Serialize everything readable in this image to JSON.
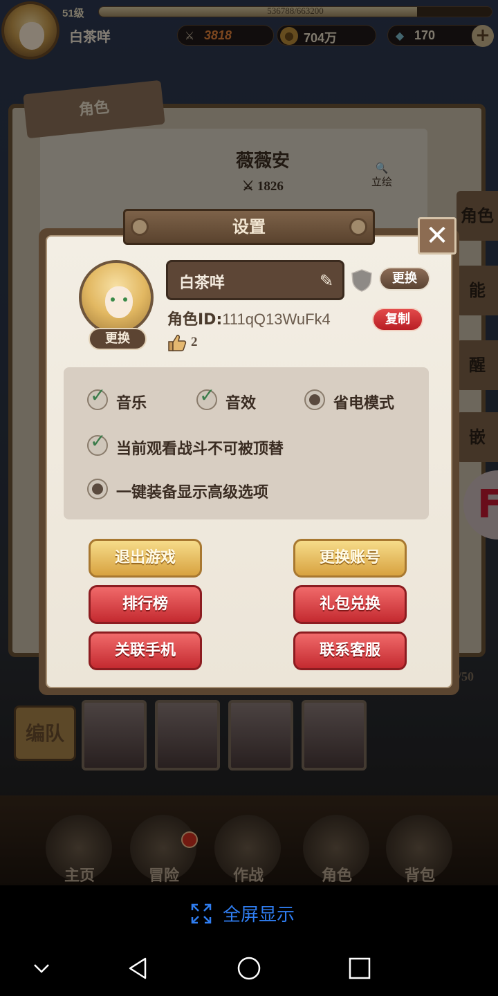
{
  "hud": {
    "level": "51级",
    "exp_text": "536788/663200",
    "exp_fraction": 0.81,
    "player_name": "白茶咩",
    "power": "3818",
    "gold": "704万",
    "gems": "170",
    "plus": "+"
  },
  "background": {
    "tab_label": "角色",
    "character_name": "薇薇安",
    "character_power": "1826",
    "portrait_label": "立绘",
    "side_tabs": [
      "角色",
      "能",
      "醒",
      "嵌"
    ],
    "team_button": "编队",
    "count_label": "/50",
    "nav": [
      "主页",
      "冒险",
      "作战",
      "角色",
      "背包"
    ]
  },
  "dialog": {
    "title": "设置",
    "close": "✕",
    "avatar_change": "更换",
    "name": "白茶咩",
    "name_change": "更换",
    "id_label": "角色ID:",
    "id_value": "111qQ13WuFk4",
    "copy": "复制",
    "likes": "2",
    "options": {
      "music": "音乐",
      "sound": "音效",
      "power_save": "省电模式",
      "no_replace": "当前观看战斗不可被顶替",
      "advanced_equip": "一键装备显示高级选项"
    },
    "buttons": {
      "exit_game": "退出游戏",
      "switch_account": "更换账号",
      "ranking": "排行榜",
      "gift_code": "礼包兑换",
      "link_phone": "关联手机",
      "contact_support": "联系客服"
    }
  },
  "system": {
    "fullscreen": "全屏显示"
  },
  "colors": {
    "accent_blue": "#2f7df0",
    "gold_button": "#d8a240",
    "red_button": "#c42a30",
    "check_green": "#3a7c4a"
  }
}
